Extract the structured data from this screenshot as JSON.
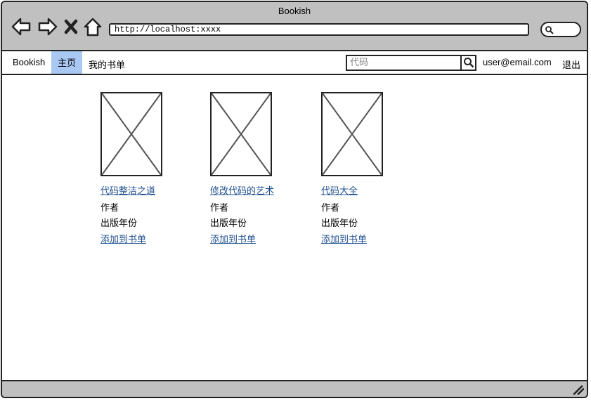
{
  "window": {
    "title": "Bookish"
  },
  "browser": {
    "url": "http://localhost:xxxx",
    "icons": [
      "back-arrow-icon",
      "forward-arrow-icon",
      "close-x-icon",
      "home-icon",
      "search-icon"
    ]
  },
  "navbar": {
    "brand": "Bookish",
    "items": [
      {
        "label": "主页",
        "active": true
      },
      {
        "label": "我的书单",
        "active": false
      }
    ],
    "search": {
      "placeholder": "代码",
      "value": ""
    },
    "user": "user@email.com",
    "logout": "退出",
    "active_color": "#a9c8f3"
  },
  "books": [
    {
      "title": "代码整洁之道",
      "author": "作者",
      "year": "出版年份",
      "action": "添加到书单"
    },
    {
      "title": "修改代码的艺术",
      "author": "作者",
      "year": "出版年份",
      "action": "添加到书单"
    },
    {
      "title": "代码大全",
      "author": "作者",
      "year": "出版年份",
      "action": "添加到书单"
    }
  ],
  "colors": {
    "chrome": "#c0c0c0",
    "link": "#1f4f8f"
  }
}
